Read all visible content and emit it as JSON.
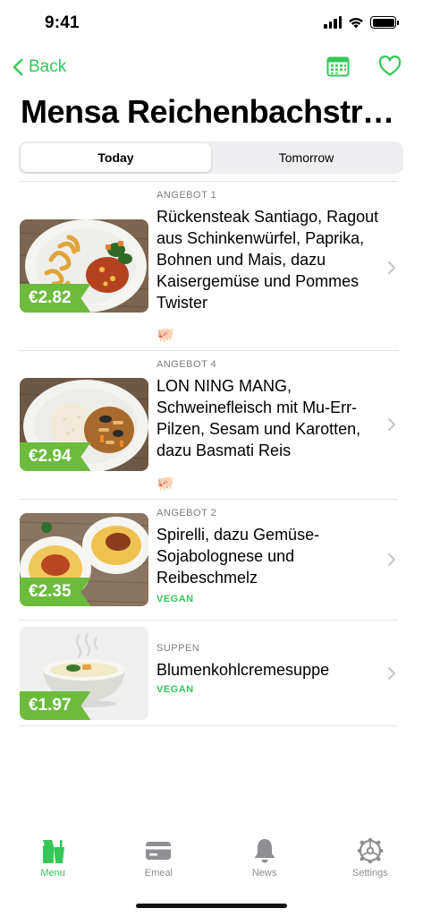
{
  "status": {
    "time": "9:41"
  },
  "nav": {
    "back_label": "Back"
  },
  "page": {
    "title": "Mensa Reichenbachstr…"
  },
  "segments": [
    {
      "label": "Today",
      "active": true
    },
    {
      "label": "Tomorrow",
      "active": false
    }
  ],
  "meals": [
    {
      "category": "ANGEBOT 1",
      "name": "Rückensteak Santiago, Ragout aus Schinkenwürfel, Paprika, Bohnen und Mais, dazu Kaisergemüse und Pommes Twister",
      "price": "€2.82",
      "icon": "pig-icon"
    },
    {
      "category": "ANGEBOT 4",
      "name": "LON NING MANG, Schweinefleisch mit Mu-Err-Pilzen, Sesam und Karotten, dazu Basmati Reis",
      "price": "€2.94",
      "icon": "pig-icon"
    },
    {
      "category": "ANGEBOT 2",
      "name": "Spirelli, dazu Gemüse-Sojabolognese und Reibeschmelz",
      "price": "€2.35",
      "tag": "VEGAN"
    },
    {
      "category": "SUPPEN",
      "name": "Blumenkohlcremesuppe",
      "price": "€1.97",
      "tag": "VEGAN"
    }
  ],
  "tabs": [
    {
      "label": "Menu",
      "icon": "menu-cup-icon",
      "active": true
    },
    {
      "label": "Emeal",
      "icon": "card-icon",
      "active": false
    },
    {
      "label": "News",
      "icon": "bell-icon",
      "active": false
    },
    {
      "label": "Settings",
      "icon": "gear-icon",
      "active": false
    }
  ],
  "colors": {
    "accent": "#35c759",
    "price_tag": "#6cbb3c",
    "inactive": "#8e8e93"
  }
}
